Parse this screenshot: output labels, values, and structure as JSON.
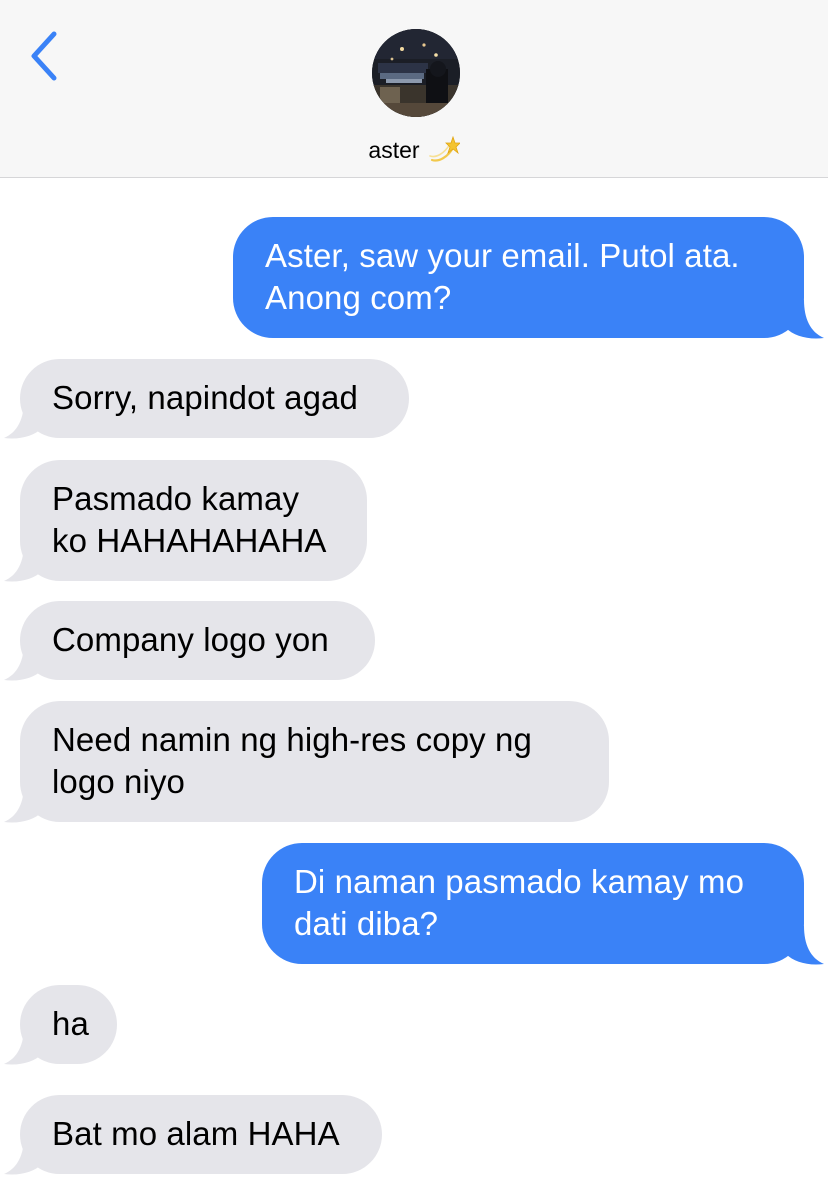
{
  "header": {
    "contact_name": "aster",
    "contact_emoji": "💫",
    "back_icon": "chevron-left-icon",
    "accent_color": "#3a82f7"
  },
  "colors": {
    "sent_bubble": "#3a82f7",
    "received_bubble": "#e5e5ea",
    "header_background": "#f7f7f7"
  },
  "messages": [
    {
      "direction": "sent",
      "text": "Aster, saw your email. Putol ata. Anong com?"
    },
    {
      "direction": "received",
      "text": "Sorry, napindot agad"
    },
    {
      "direction": "received",
      "text": "Pasmado kamay ko HAHAHAHAHA"
    },
    {
      "direction": "received",
      "text": "Company logo yon"
    },
    {
      "direction": "received",
      "text": "Need namin ng high-res copy ng logo niyo"
    },
    {
      "direction": "sent",
      "text": "Di naman pasmado kamay mo dati diba?"
    },
    {
      "direction": "received",
      "text": "ha"
    },
    {
      "direction": "received",
      "text": "Bat mo alam HAHA"
    }
  ]
}
